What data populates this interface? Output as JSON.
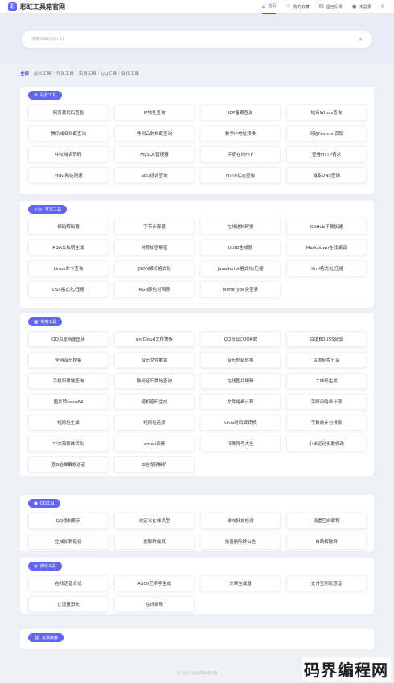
{
  "header": {
    "logo_text": "彩虹工具箱官网",
    "logo_mark": "彩",
    "nav": [
      {
        "label": "首页",
        "icon": "⌂",
        "active": true
      },
      {
        "label": "我的收藏",
        "icon": "♡"
      },
      {
        "label": "留言反馈",
        "icon": "✉"
      },
      {
        "label": "未登录",
        "icon": "◉"
      }
    ],
    "theme_icon": "☾"
  },
  "search": {
    "placeholder": "搜索工具(Ctrl+K)"
  },
  "categories": [
    "全部",
    "站长工具",
    "开发工具",
    "实用工具",
    "QQ工具",
    "娱乐工具"
  ],
  "sections": [
    {
      "title": "站长工具",
      "icon": "⚙",
      "tools": [
        "网页源代码查看",
        "IP地址查询",
        "ICP备案查询",
        "域名Whois查询",
        "腾讯域名拦截查询",
        "净网云剑拦截查询",
        "数字IP地址转换",
        "网站Favicon获取",
        "中文域名转码",
        "MySQL管理器",
        "手机在线FTP",
        "查看HTTP请求",
        "PING网站测速",
        "SEO综合查询",
        "HTTP状态查询",
        "域名DNS查询"
      ]
    },
    {
      "title": "开发工具",
      "icon": "</>",
      "tools": [
        "编码解码器",
        "字节计算器",
        "在线进制转换",
        "GitHub下载加速",
        "RSA公私钥生成",
        "对称加密解密",
        "UUID生成器",
        "Markdown在线编辑",
        "Linux命令查询",
        "JSON解析格式化",
        "JavaScript格式化/压缩",
        "Html格式化/压缩",
        "CSS格式化/压缩",
        "RGB颜色对照表",
        "MimeType类型表"
      ]
    },
    {
      "title": "实用工具",
      "icon": "▦",
      "tools": [
        "QQ百度网速图床",
        "uniCloud文件快传",
        "QQ获取COOKIE",
        "百度BDUSS获取",
        "全网音乐搜索",
        "音乐文件解锁",
        "音乐外链转换",
        "百度网盘分享",
        "手机归属地查询",
        "身份证归属地查询",
        "在线图片编辑",
        "二维码生成",
        "图片转base64",
        "随机密码生成",
        "文件哈希计算",
        "字符串哈希计算",
        "短网址生成",
        "短网址还原",
        "Unix时间戳转换",
        "字数统计与排版",
        "中文简繁体转化",
        "emoji表情",
        "特殊符号大全",
        "小米运动步数修改",
        "查B站弹幕发送者",
        "B站视频解析"
      ]
    },
    {
      "title": "QQ工具",
      "icon": "●",
      "tools": [
        "QQ强制聊天",
        "自定义在线机型",
        "单向好友检测",
        "设置空白昵称",
        "生成加群链接",
        "提取群成员",
        "批量删除群公告",
        "自助解散群"
      ]
    },
    {
      "title": "娱乐工具",
      "icon": "◍",
      "tools": [
        "在线语音合成",
        "ASCII艺术字生成",
        "文章生成器",
        "支付宝到账语音",
        "让流量消失",
        "在线钢琴"
      ]
    },
    {
      "title": "友情链接",
      "icon": "⛓",
      "tools": []
    }
  ],
  "footer": {
    "text": "© 2024 彩虹工具箱官网"
  },
  "watermark": "码界编程网"
}
